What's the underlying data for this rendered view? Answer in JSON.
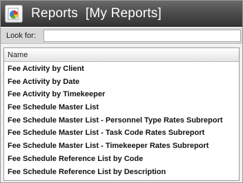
{
  "window": {
    "title": "Reports  [My Reports]",
    "icon": "reports-app-icon"
  },
  "search": {
    "label": "Look for:",
    "value": "",
    "placeholder": ""
  },
  "list": {
    "column_header": "Name",
    "items": [
      "Fee Activity by Client",
      "Fee Activity by Date",
      "Fee Activity by Timekeeper",
      "Fee Schedule Master List",
      "Fee Schedule Master List - Personnel Type Rates Subreport",
      "Fee Schedule Master List - Task Code Rates Subreport",
      "Fee Schedule Master List - Timekeeper Rates Subreport",
      "Fee Schedule Reference List by Code",
      "Fee Schedule Reference List by Description"
    ]
  },
  "colors": {
    "titlebar": "#4e4e4e",
    "title_text": "#ffffff",
    "lookfor_bar": "#d8d8d8"
  }
}
